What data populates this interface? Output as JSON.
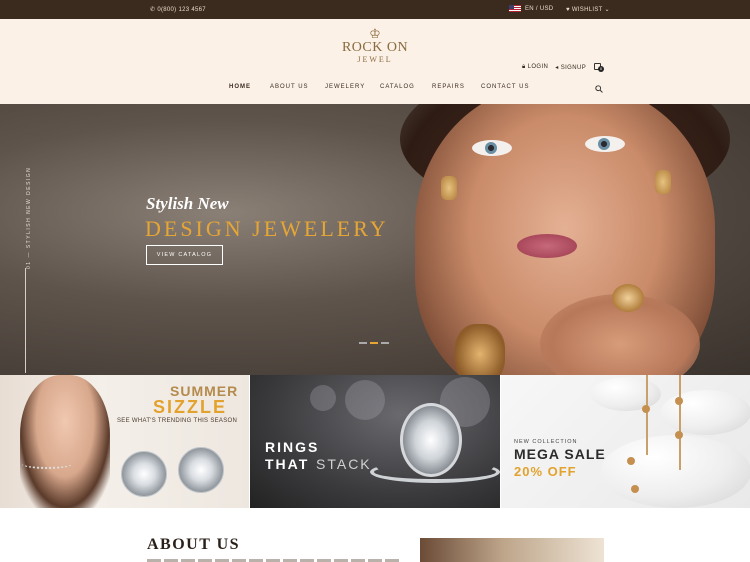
{
  "topbar": {
    "phone": "0(800) 123 4567",
    "currency": "EN / USD",
    "wishlist": "WISHLIST"
  },
  "header": {
    "logo_line1": "ROCK ON",
    "logo_line2": "JEWEL",
    "login": "LOGIN",
    "signup": "SIGNUP",
    "cart_count": "0"
  },
  "nav": {
    "items": [
      "HOME",
      "ABOUT US",
      "JEWELERY",
      "CATALOG",
      "REPAIRS",
      "CONTACT US"
    ]
  },
  "hero": {
    "side_text": "STYLISH NEW DESIGN",
    "side_number": "01",
    "script_title": "Stylish New",
    "headline": "DESIGN JEWELERY",
    "button": "VIEW CATALOG",
    "active_slide": 2,
    "slide_count": 3
  },
  "banners": {
    "summer": {
      "line1": "SUMMER",
      "line2": "SIZZLE",
      "line3": "SEE WHAT'S TRENDING THIS SEASON"
    },
    "rings": {
      "line1": "RINGS",
      "line2_bold": "THAT",
      "line2_light": "STACK"
    },
    "sale": {
      "kicker": "NEW COLLECTION",
      "title": "MEGA SALE",
      "discount": "20% OFF"
    }
  },
  "about": {
    "title": "ABOUT US"
  },
  "colors": {
    "topbar_bg": "#3b2a1e",
    "header_bg": "#fbf1e6",
    "accent_gold": "#e2a22d"
  }
}
